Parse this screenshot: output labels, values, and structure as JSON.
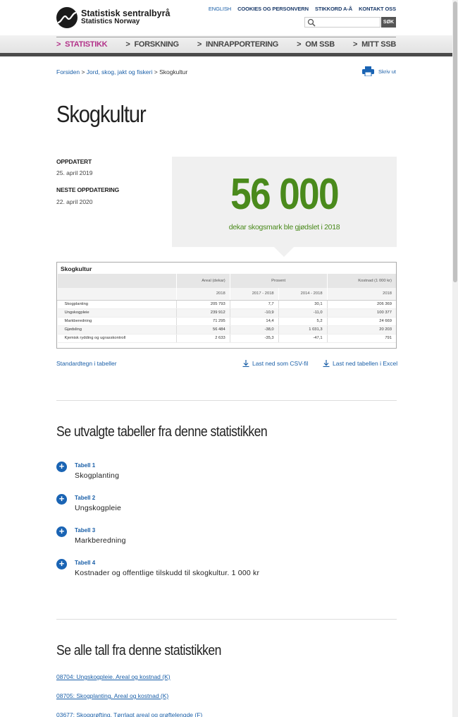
{
  "header": {
    "logo_line1": "Statistisk sentralbyrå",
    "logo_line2": "Statistics Norway",
    "top_links": [
      "ENGLISH",
      "COOKIES OG PERSONVERN",
      "STIKKORD A-Å",
      "KONTAKT OSS"
    ],
    "search_placeholder": "",
    "search_button": "SØK"
  },
  "nav": {
    "chevron": ">",
    "items": [
      "STATISTIKK",
      "FORSKNING",
      "INNRAPPORTERING",
      "OM SSB",
      "MITT SSB"
    ]
  },
  "breadcrumb": {
    "items": [
      "Forsiden",
      "Jord, skog, jakt og fiskeri",
      "Skogkultur"
    ],
    "separator": ">"
  },
  "print_label": "Skriv ut",
  "page_title": "Skogkultur",
  "meta": {
    "updated_label": "OPPDATERT",
    "updated_value": "25. april 2019",
    "next_label": "NESTE OPPDATERING",
    "next_value": "22. april 2020"
  },
  "key_figure": {
    "value": "56 000",
    "text": "dekar skogsmark ble gjødslet i 2018"
  },
  "table": {
    "caption": "Skogkultur",
    "group_headers": [
      "Areal (dekar)",
      "Prosent",
      "Kostnad (1 000 kr)"
    ],
    "year_headers": [
      "2018",
      "2017 - 2018",
      "2014 - 2018",
      "2018"
    ],
    "rows": [
      {
        "label": "Skogplanting",
        "values": [
          "205 793",
          "7,7",
          "30,1",
          "206 369"
        ]
      },
      {
        "label": "Ungskogpleie",
        "values": [
          "239 912",
          "-10,9",
          "-11,0",
          "100 377"
        ]
      },
      {
        "label": "Markberedning",
        "values": [
          "71 295",
          "14,4",
          "5,2",
          "24 669"
        ]
      },
      {
        "label": "Gjødsling",
        "values": [
          "56 484",
          "-38,0",
          "1 031,3",
          "20 203"
        ]
      },
      {
        "label": "Kjemisk rydding og ugrasskontroll",
        "values": [
          "2 633",
          "-35,3",
          "-47,1",
          "791"
        ]
      }
    ]
  },
  "table_links": {
    "standard": "Standardtegn i tabeller",
    "csv": "Last ned som CSV-fil",
    "excel": "Last ned tabellen i Excel"
  },
  "selected_tables": {
    "heading": "Se utvalgte tabeller fra denne statistikken",
    "items": [
      {
        "num": "Tabell 1",
        "name": "Skogplanting"
      },
      {
        "num": "Tabell 2",
        "name": "Ungskogpleie"
      },
      {
        "num": "Tabell 3",
        "name": "Markberedning"
      },
      {
        "num": "Tabell 4",
        "name": "Kostnader og offentlige tilskudd til skogkultur. 1 000 kr"
      }
    ]
  },
  "all_figures": {
    "heading": "Se alle tall fra denne statistikken",
    "links": [
      "08704: Ungskogpleie. Areal og kostnad (K)",
      "08705: Skogplanting. Areal og kostnad (K)",
      "03677: Skoggrøfting. Tørrlagt areal og grøftelengde (F)"
    ]
  },
  "colors": {
    "accent_green": "#4a8a1c",
    "nav_active": "#b23289",
    "link_blue": "#1a5fa8"
  }
}
